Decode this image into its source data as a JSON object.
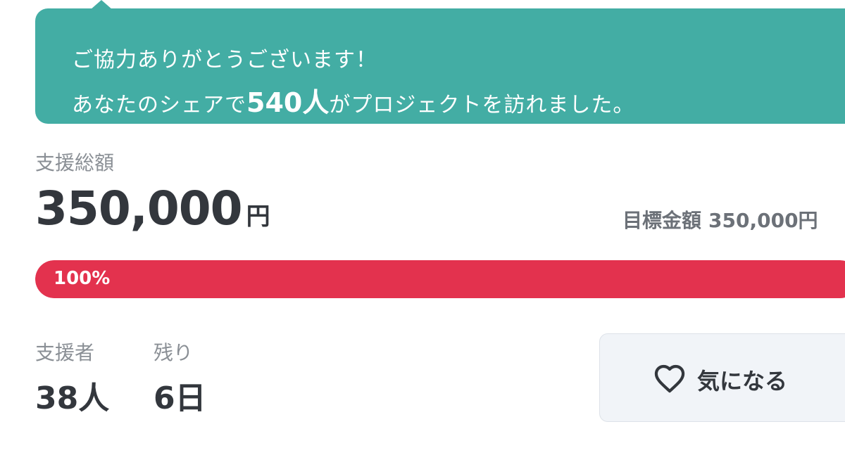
{
  "share_callout": {
    "line1": "ご協力ありがとうございます！",
    "line2_prefix": "あなたのシェアで",
    "line2_highlight": "540人",
    "line2_suffix": "がプロジェクトを訪れました。"
  },
  "funding": {
    "total_label": "支援総額",
    "total_value": "350,000",
    "total_unit": "円",
    "goal_label": "目標金額",
    "goal_value": "350,000円"
  },
  "progress": {
    "percent_label": "100%",
    "fraction": 1.0
  },
  "stats": {
    "supporters_label": "支援者",
    "supporters_value": "38人",
    "remaining_label": "残り",
    "remaining_value": "6日"
  },
  "favorite": {
    "label": "気になる",
    "icon": "heart-icon"
  },
  "colors": {
    "callout_bg": "#43ada4",
    "progress_fill": "#e3324e",
    "button_bg": "#f1f4f8"
  }
}
